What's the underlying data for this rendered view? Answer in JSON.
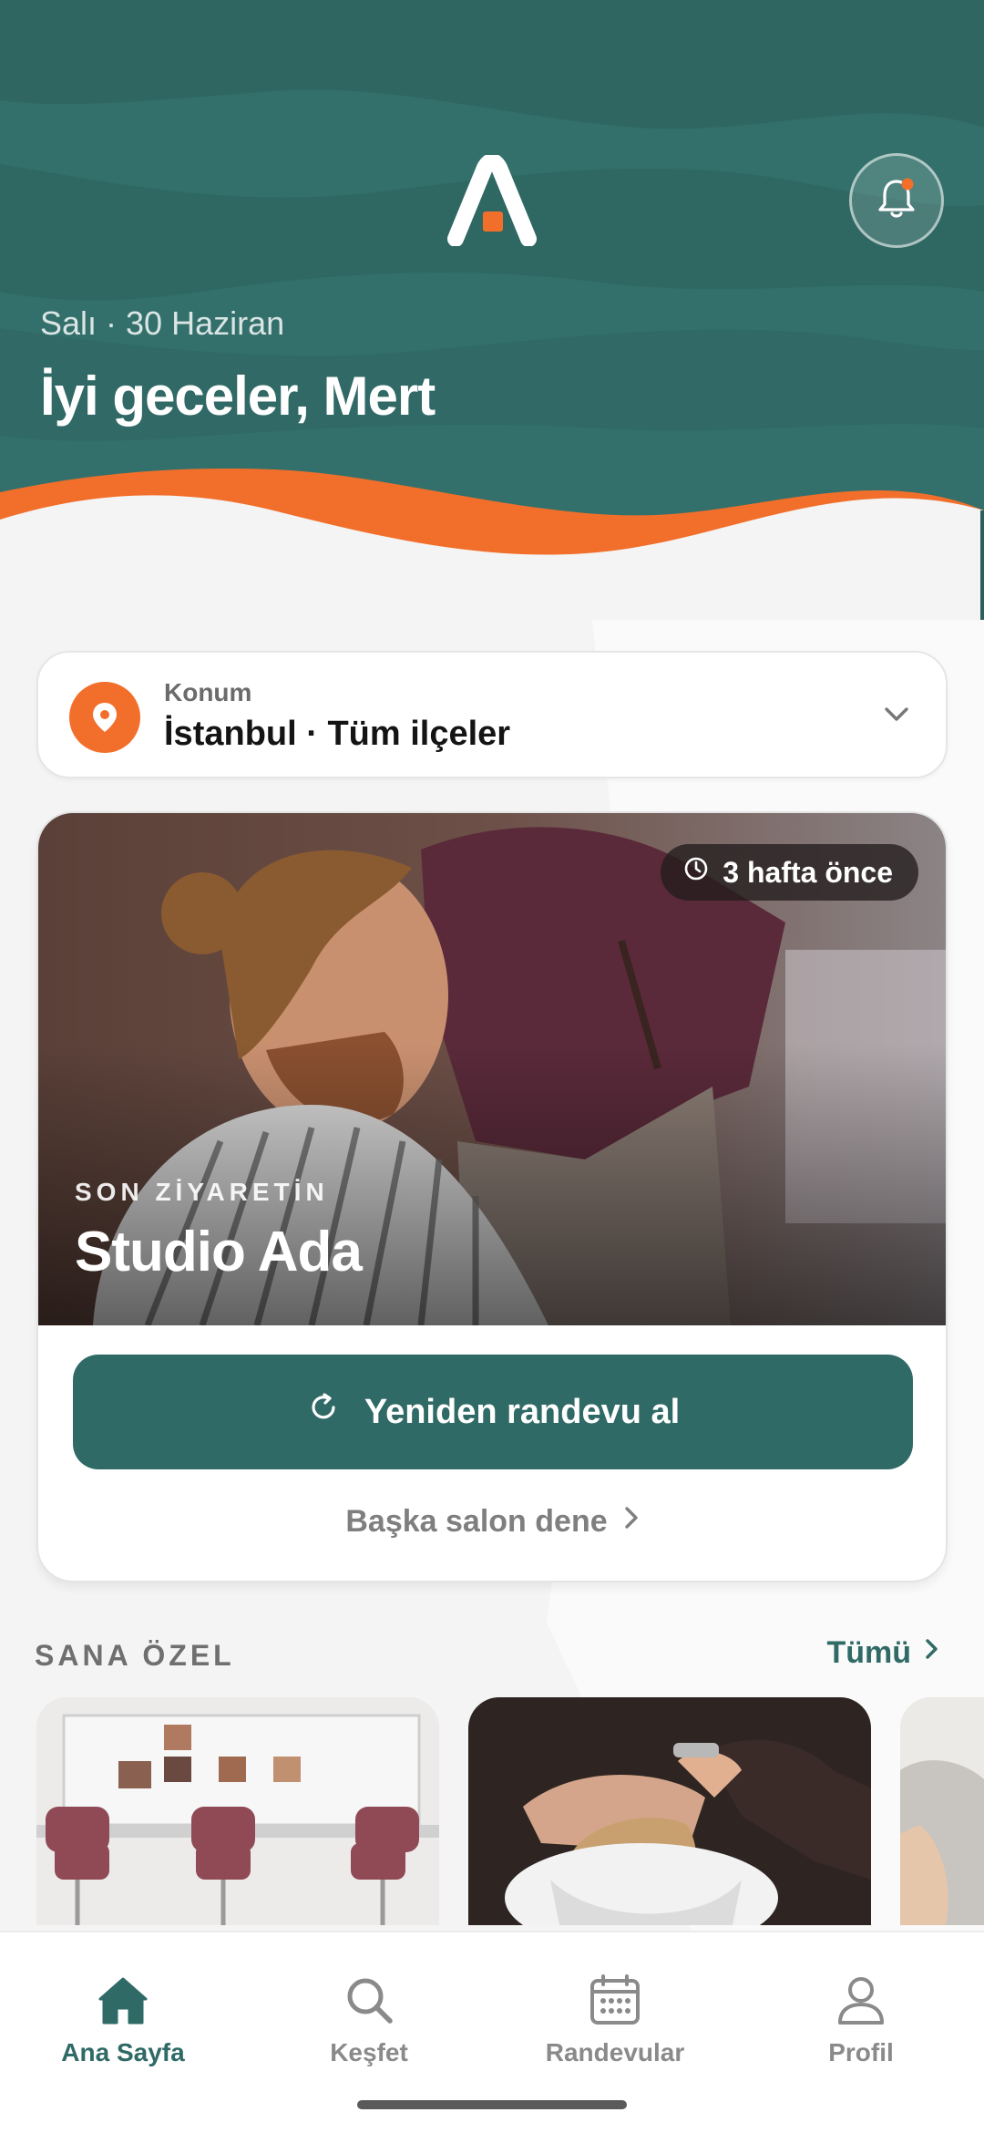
{
  "header": {
    "date": "Salı · 30 Haziran",
    "greeting": "İyi geceler, Mert"
  },
  "location": {
    "label": "Konum",
    "value": "İstanbul · Tüm ilçeler"
  },
  "last_visit": {
    "time_ago": "3 hafta önce",
    "kicker": "SON ZİYARETİN",
    "salon_name": "Studio Ada",
    "rebook_label": "Yeniden randevu al",
    "other_salon_label": "Başka salon dene"
  },
  "for_you": {
    "title": "SANA ÖZEL",
    "see_all": "Tümü"
  },
  "nav": {
    "items": [
      {
        "label": "Ana Sayfa",
        "icon": "home-icon",
        "active": true
      },
      {
        "label": "Keşfet",
        "icon": "search-icon",
        "active": false
      },
      {
        "label": "Randevular",
        "icon": "calendar-icon",
        "active": false
      },
      {
        "label": "Profil",
        "icon": "profile-icon",
        "active": false
      }
    ]
  },
  "colors": {
    "teal": "#2f6a66",
    "teal_dark": "#2c5f5c",
    "orange": "#f26f2b",
    "background": "#f4f4f4"
  }
}
